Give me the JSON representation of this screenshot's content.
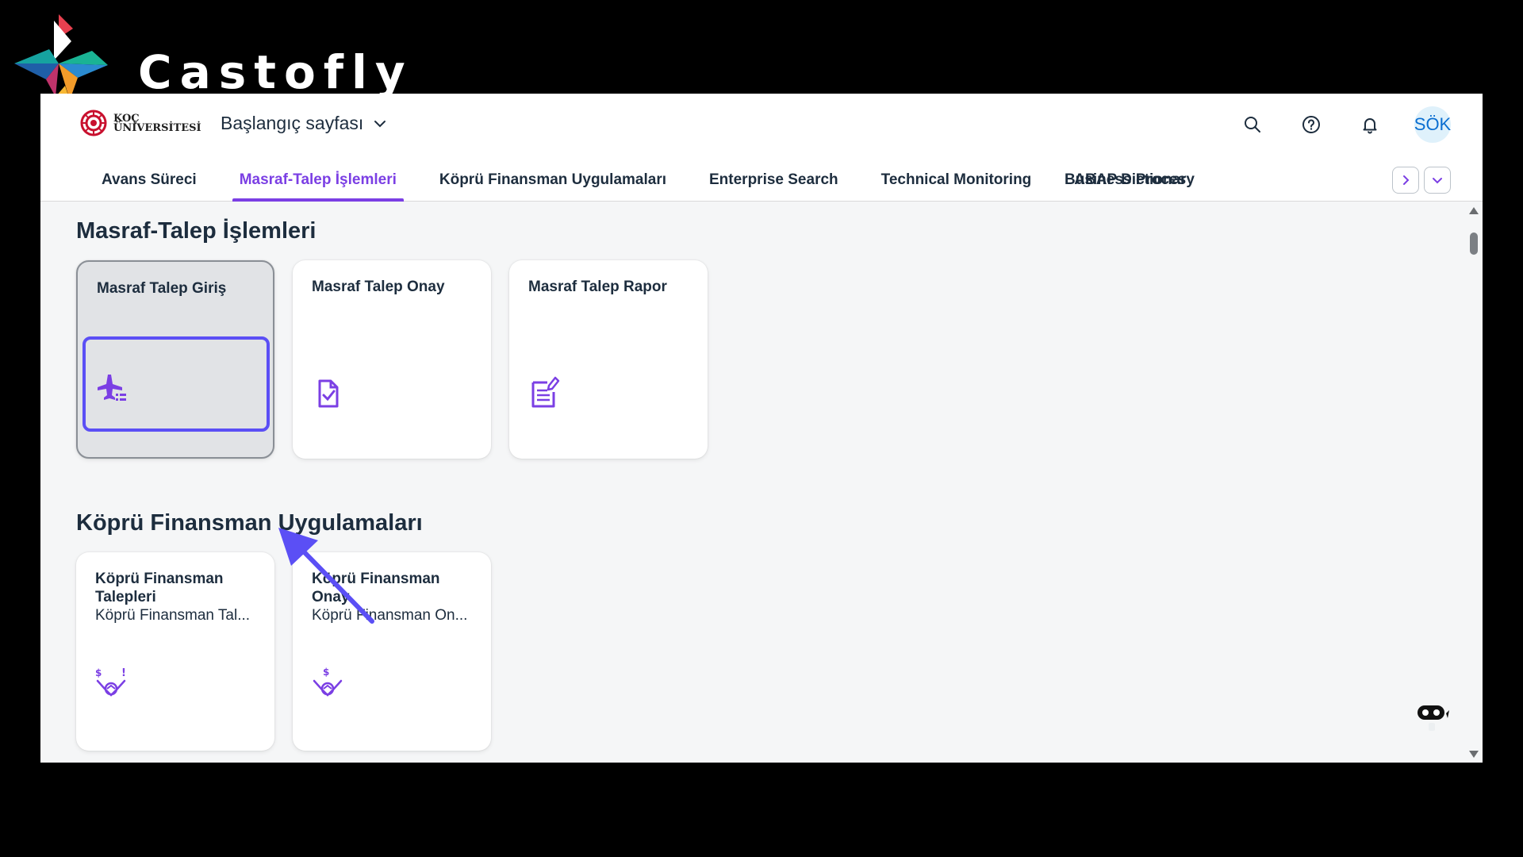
{
  "brand": {
    "name": "Castofly"
  },
  "shell": {
    "company_line1": "KOÇ",
    "company_line2": "ÜNİVERSİTESİ",
    "home_title": "Başlangıç sayfası",
    "avatar_initials": "SÖK"
  },
  "tabs": [
    {
      "label": "Avans Süreci"
    },
    {
      "label": "Masraf-Talep İşlemleri",
      "active": true
    },
    {
      "label": "Köprü Finansman Uygulamaları"
    },
    {
      "label": "Enterprise Search"
    },
    {
      "label": "Technical Monitoring"
    },
    {
      "label": "ABAP Dictionary"
    },
    {
      "label": "Business Proces"
    }
  ],
  "sections": [
    {
      "title": "Masraf-Talep İşlemleri",
      "tiles": [
        {
          "title": "Masraf Talep Giriş",
          "icon": "travel-expense-icon",
          "selected": true
        },
        {
          "title": "Masraf Talep Onay",
          "icon": "document-approval-icon"
        },
        {
          "title": "Masraf Talep Rapor",
          "icon": "report-edit-icon"
        }
      ]
    },
    {
      "title": "Köprü Finansman Uygulamaları",
      "tiles": [
        {
          "title": "Köprü Finansman Talepleri",
          "subtitle": "Köprü Finansman Tal...",
          "icon": "deal-request-icon"
        },
        {
          "title": "Köprü Finansman Onay",
          "subtitle": "Köprü Finansman On...",
          "icon": "deal-approval-icon"
        }
      ]
    }
  ],
  "colors": {
    "accent": "#7b3fe4",
    "focus": "#5b4ff5",
    "background": "#f5f6f7"
  }
}
